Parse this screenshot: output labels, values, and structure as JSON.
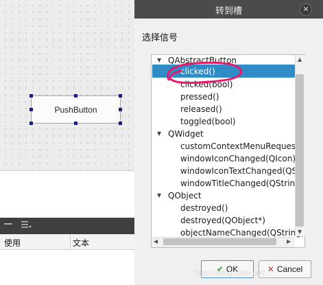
{
  "canvas": {
    "push_button_label": "PushButton"
  },
  "bottom_panel": {
    "columns": [
      "使用",
      "文本"
    ]
  },
  "dialog": {
    "title": "转到槽",
    "close_glyph": "✕",
    "group_label": "选择信号",
    "tree": [
      {
        "label": "QAbstractButton",
        "kind": "parent"
      },
      {
        "label": "clicked()",
        "kind": "child",
        "selected": true
      },
      {
        "label": "clicked(bool)",
        "kind": "child"
      },
      {
        "label": "pressed()",
        "kind": "child"
      },
      {
        "label": "released()",
        "kind": "child"
      },
      {
        "label": "toggled(bool)",
        "kind": "child"
      },
      {
        "label": "QWidget",
        "kind": "parent"
      },
      {
        "label": "customContextMenuRequested(QPoint)",
        "kind": "child"
      },
      {
        "label": "windowIconChanged(QIcon)",
        "kind": "child"
      },
      {
        "label": "windowIconTextChanged(QString)",
        "kind": "child"
      },
      {
        "label": "windowTitleChanged(QString)",
        "kind": "child"
      },
      {
        "label": "QObject",
        "kind": "parent"
      },
      {
        "label": "destroyed()",
        "kind": "child"
      },
      {
        "label": "destroyed(QObject*)",
        "kind": "child"
      },
      {
        "label": "objectNameChanged(QString)",
        "kind": "child"
      }
    ],
    "ok_label": "OK",
    "cancel_label": "Cancel",
    "ok_icon": "check-icon",
    "cancel_icon": "cancel-icon"
  },
  "watermark": "https://blog.csdn.net/...",
  "colors": {
    "selection": "#308cc6",
    "annotation": "#e8186a",
    "titlebar": "#4b4b4b"
  }
}
